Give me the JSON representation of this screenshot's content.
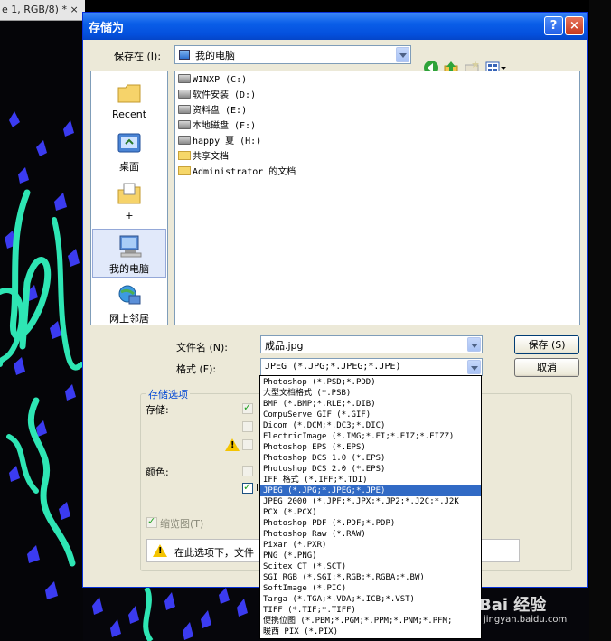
{
  "background": {
    "doc_tab": "e 1, RGB/8) * ×"
  },
  "dialog": {
    "title": "存储为",
    "help": "?",
    "close": "×",
    "save_in_label": "保存在 (I):",
    "save_in_value": "我的电脑",
    "places": [
      {
        "label": "Recent",
        "icon": "recent-folder-icon"
      },
      {
        "label": "桌面",
        "icon": "desktop-icon"
      },
      {
        "label": "+",
        "icon": "my-documents-icon"
      },
      {
        "label": "我的电脑",
        "icon": "my-computer-icon"
      },
      {
        "label": "网上邻居",
        "icon": "network-icon"
      }
    ],
    "files": [
      {
        "name": "WINXP (C:)",
        "type": "drive"
      },
      {
        "name": "软件安装 (D:)",
        "type": "drive"
      },
      {
        "name": "资料盘 (E:)",
        "type": "drive"
      },
      {
        "name": "本地磁盘 (F:)",
        "type": "drive"
      },
      {
        "name": "happy 夏 (H:)",
        "type": "drive"
      },
      {
        "name": "共享文档",
        "type": "folder"
      },
      {
        "name": "Administrator 的文档",
        "type": "folder"
      }
    ],
    "filename_label": "文件名 (N):",
    "filename_value": "成品.jpg",
    "format_label": "格式 (F):",
    "format_value": "JPEG (*.JPG;*.JPEG;*.JPE)",
    "save_button": "保存 (S)",
    "cancel_button": "取消",
    "options_title": "存储选项",
    "store_label": "存储:",
    "color_label": "颜色:",
    "thumbnail_label": "缩览图(T)",
    "info_text": "在此选项下，文件",
    "partial_i": "I"
  },
  "format_options": [
    "Photoshop (*.PSD;*.PDD)",
    "大型文档格式 (*.PSB)",
    "BMP (*.BMP;*.RLE;*.DIB)",
    "CompuServe GIF (*.GIF)",
    "Dicom (*.DCM;*.DC3;*.DIC)",
    "ElectricImage (*.IMG;*.EI;*.EIZ;*.EIZZ)",
    "Photoshop EPS (*.EPS)",
    "Photoshop DCS 1.0 (*.EPS)",
    "Photoshop DCS 2.0 (*.EPS)",
    "IFF 格式 (*.IFF;*.TDI)",
    "JPEG (*.JPG;*.JPEG;*.JPE)",
    "JPEG 2000 (*.JPF;*.JPX;*.JP2;*.J2C;*.J2K",
    "PCX (*.PCX)",
    "Photoshop PDF (*.PDF;*.PDP)",
    "Photoshop Raw (*.RAW)",
    "Pixar (*.PXR)",
    "PNG (*.PNG)",
    "Scitex CT (*.SCT)",
    "SGI RGB (*.SGI;*.RGB;*.RGBA;*.BW)",
    "SoftImage (*.PIC)",
    "Targa (*.TGA;*.VDA;*.ICB;*.VST)",
    "TIFF (*.TIF;*.TIFF)",
    "便携位图 (*.PBM;*.PGM;*.PPM;*.PNM;*.PFM;",
    "暖西 PIX (*.PIX)"
  ],
  "selected_format_index": 10,
  "watermark": "Bai 经验",
  "watermark_url": "jingyan.baidu.com",
  "colors": {
    "title_blue": "#0a5ee8",
    "dialog_face": "#ece9d8",
    "selection": "#316ac5",
    "group_title": "#0046d5"
  }
}
